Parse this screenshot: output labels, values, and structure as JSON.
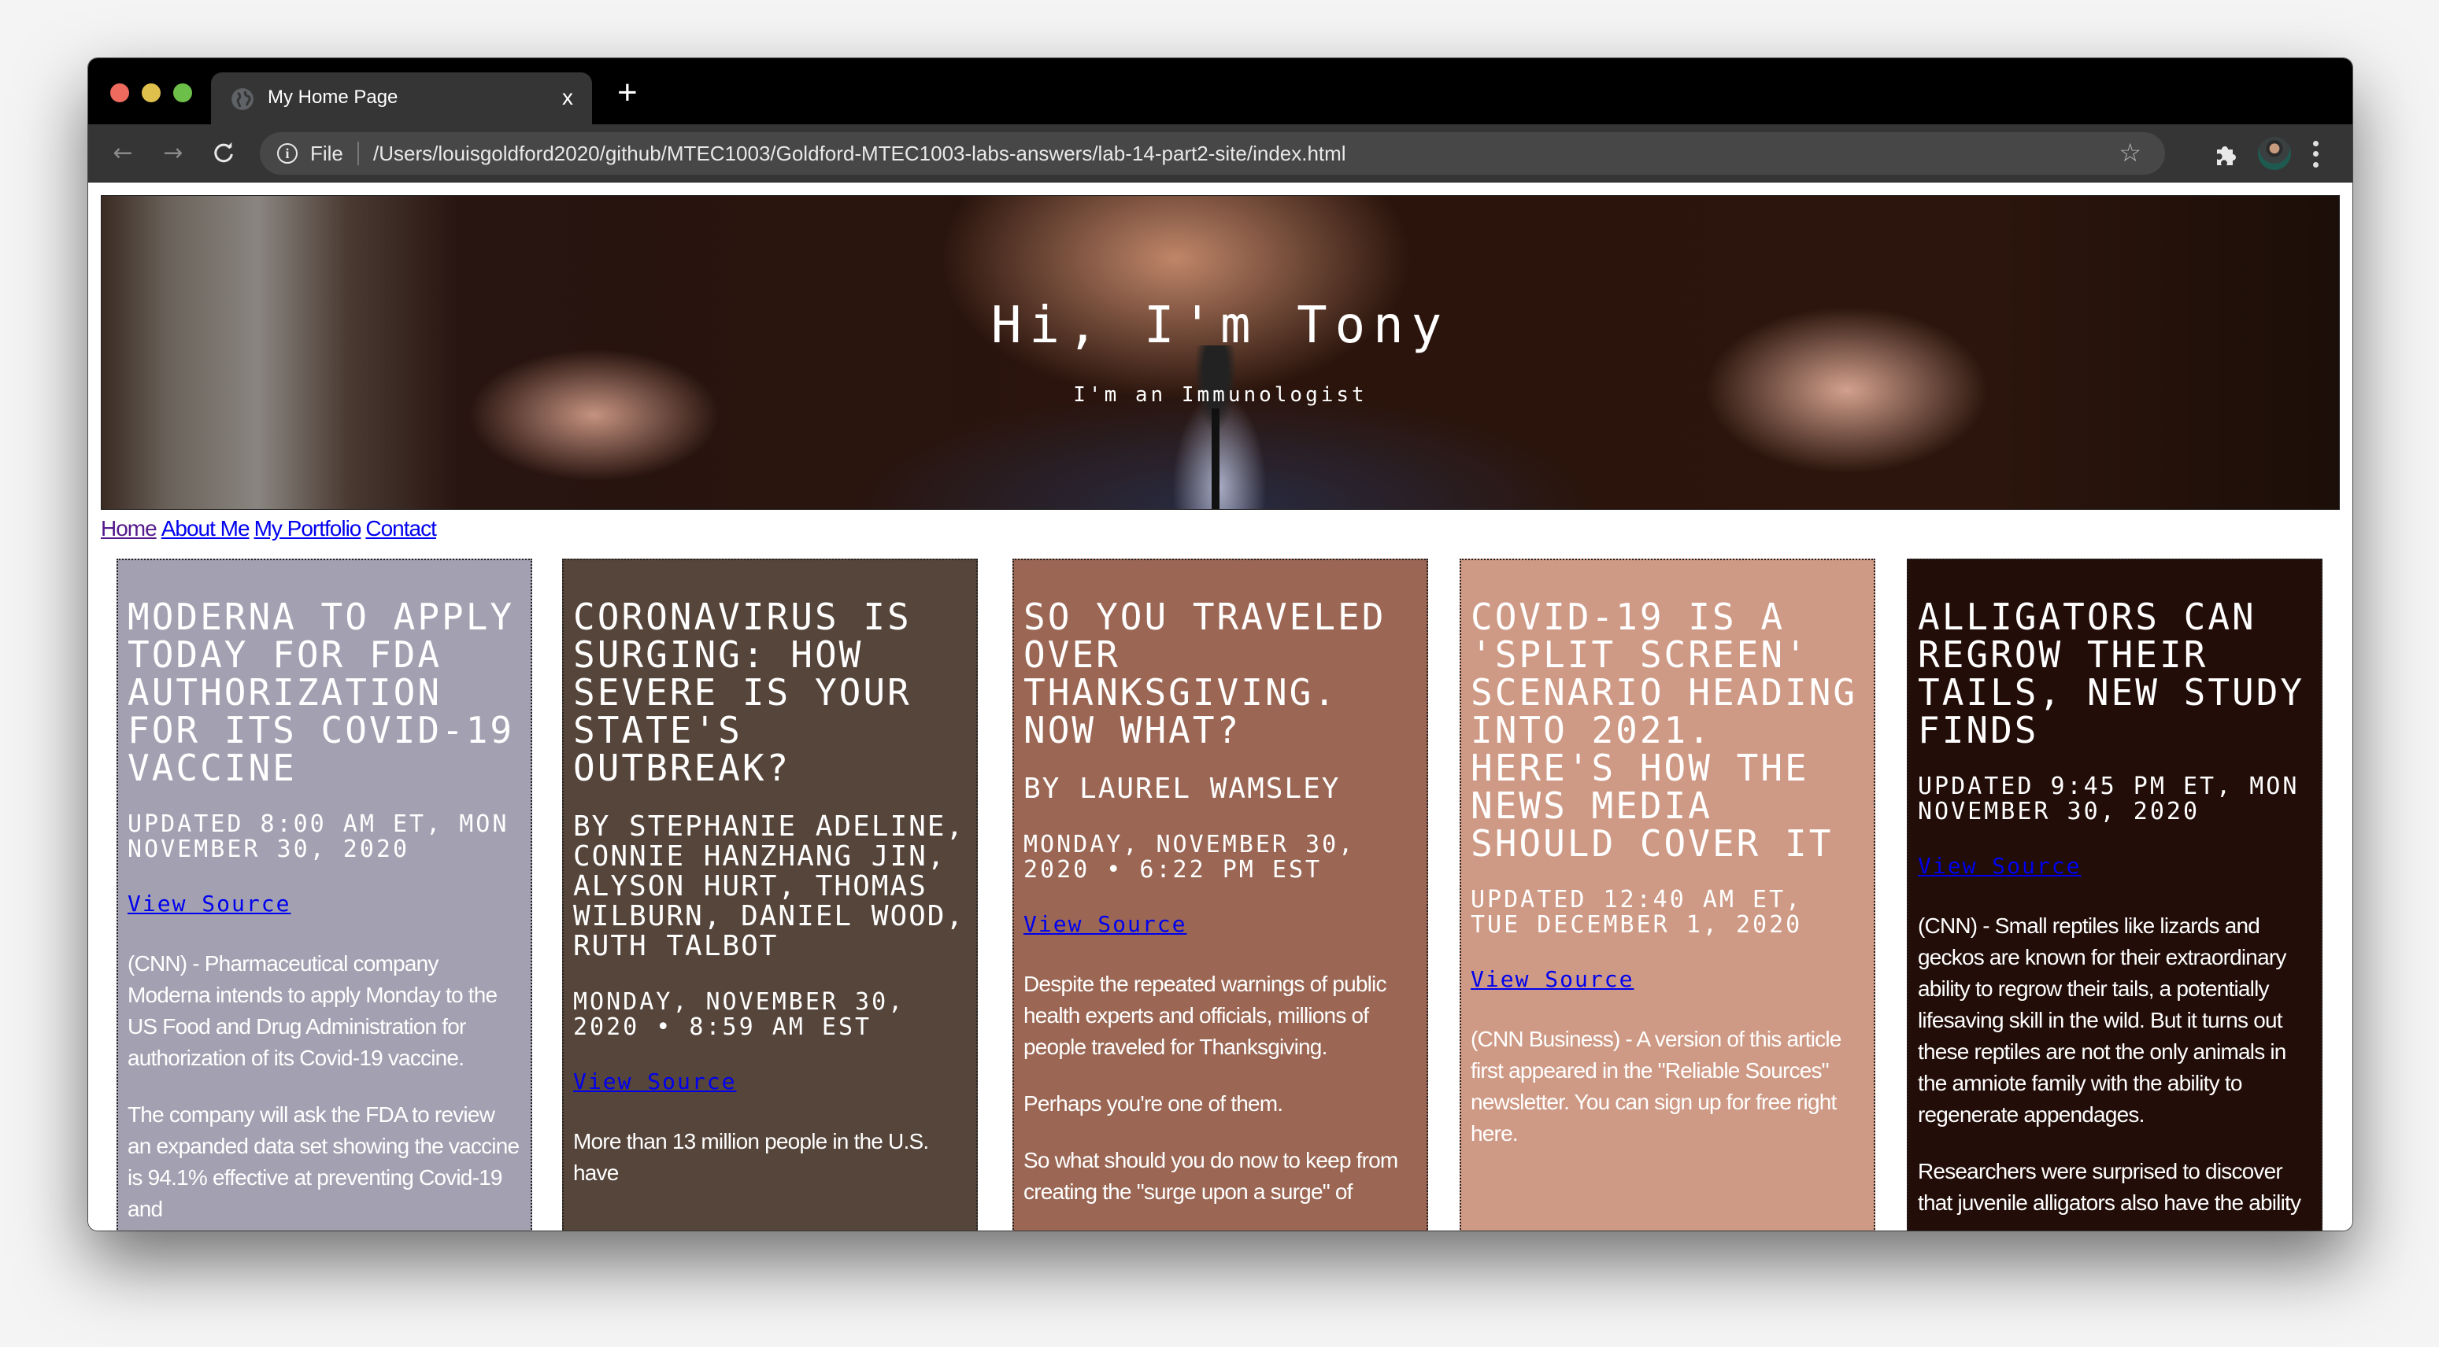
{
  "browser": {
    "tab_title": "My Home Page",
    "tab_close": "x",
    "new_tab": "+",
    "back": "←",
    "forward": "→",
    "reload": "C",
    "info": "i",
    "scheme_label": "File",
    "url": "/Users/louisgoldford2020/github/MTEC1003/Goldford-MTEC1003-labs-answers/lab-14-part2-site/index.html",
    "star": "☆"
  },
  "hero": {
    "title": "Hi, I'm Tony",
    "subtitle": "I'm an Immunologist"
  },
  "nav": {
    "links": [
      "Home",
      "About Me",
      "My Portfolio",
      "Contact"
    ]
  },
  "cards": [
    {
      "bg": "#a3a1b1",
      "headline": "Moderna to apply today for FDA authorization for its Covid-19 vaccine",
      "byline": "",
      "date": "Updated 8:00 AM ET, Mon November 30, 2020",
      "source_label": "View Source",
      "paragraphs": [
        "(CNN) - Pharmaceutical company Moderna intends to apply Monday to the US Food and Drug Administration for authorization of its Covid-19 vaccine.",
        "The company will ask the FDA to review an expanded data set showing the vaccine is 94.1% effective at preventing Covid-19 and"
      ]
    },
    {
      "bg": "#56453a",
      "headline": "Coronavirus Is Surging: How Severe Is Your State's Outbreak?",
      "byline": "By Stephanie Adeline, Connie Hanzhang Jin, Alyson Hurt, Thomas Wilburn, Daniel Wood, Ruth Talbot",
      "date": "Monday, November 30, 2020 • 8:59 AM EST",
      "source_label": "View Source",
      "paragraphs": [
        "More than 13 million people in the U.S. have"
      ]
    },
    {
      "bg": "#9b6754",
      "headline": "So You Traveled Over Thanksgiving. Now What?",
      "byline": "By Laurel Wamsley",
      "date": "Monday, November 30, 2020 • 6:22 PM EST",
      "source_label": "View Source",
      "paragraphs": [
        "Despite the repeated warnings of public health experts and officials, millions of people traveled for Thanksgiving.",
        "Perhaps you're one of them.",
        "So what should you do now to keep from creating the \"surge upon a surge\" of"
      ]
    },
    {
      "bg": "#cf9a85",
      "headline": "Covid-19 is a 'split screen' scenario heading into 2021. Here's how the news media should cover it",
      "byline": "",
      "date": "Updated 12:40 AM ET, Tue December 1, 2020",
      "source_label": "View Source",
      "paragraphs": [
        "(CNN Business) - A version of this article first appeared in the \"Reliable Sources\" newsletter. You can sign up for free right here."
      ]
    },
    {
      "bg": "#220d08",
      "headline": "Alligators can regrow their tails, new study finds",
      "byline": "",
      "date": "Updated 9:45 PM ET, Mon November 30, 2020",
      "source_label": "View Source",
      "paragraphs": [
        "(CNN) - Small reptiles like lizards and geckos are known for their extraordinary ability to regrow their tails, a potentially lifesaving skill in the wild. But it turns out these reptiles are not the only animals in the amniote family with the ability to regenerate appendages.",
        "Researchers were surprised to discover that juvenile alligators also have the ability"
      ]
    }
  ],
  "colors": {
    "link": "#0000ee",
    "visited_link": "#551a8b"
  }
}
